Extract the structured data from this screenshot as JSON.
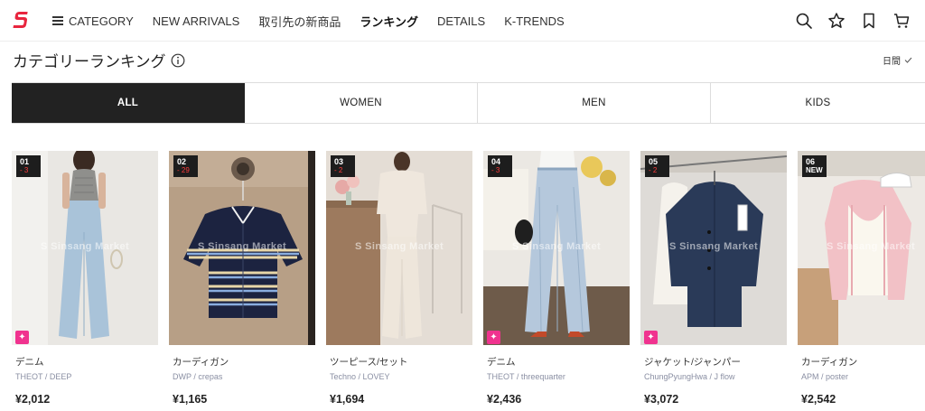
{
  "header": {
    "logo": "S",
    "nav": [
      {
        "label": "CATEGORY"
      },
      {
        "label": "NEW ARRIVALS"
      },
      {
        "label": "取引先の新商品"
      },
      {
        "label": "ランキング"
      },
      {
        "label": "DETAILS"
      },
      {
        "label": "K-TRENDS"
      }
    ],
    "icons": [
      "search-icon",
      "star-icon",
      "bookmark-icon",
      "cart-icon"
    ],
    "brand_color": "#e8253e"
  },
  "ranking": {
    "title": "カテゴリーランキング",
    "period": "日間"
  },
  "tabs": [
    {
      "label": "ALL"
    },
    {
      "label": "WOMEN"
    },
    {
      "label": "MEN"
    },
    {
      "label": "KIDS"
    }
  ],
  "watermark": "S Sinsang Market",
  "products": [
    {
      "rank": "01",
      "change": "- 3",
      "category": "デニム",
      "brand": "THEOT / DEEP",
      "price": "¥2,012"
    },
    {
      "rank": "02",
      "change": "- 29",
      "category": "カーディガン",
      "brand": "DWP / crepas",
      "price": "¥1,165"
    },
    {
      "rank": "03",
      "change": "- 2",
      "category": "ツーピース/セット",
      "brand": "Techno / LOVEY",
      "price": "¥1,694"
    },
    {
      "rank": "04",
      "change": "- 3",
      "category": "デニム",
      "brand": "THEOT / threequarter",
      "price": "¥2,436"
    },
    {
      "rank": "05",
      "change": "- 2",
      "category": "ジャケット/ジャンパー",
      "brand": "ChungPyungHwa / J flow",
      "price": "¥3,072"
    },
    {
      "rank": "06",
      "change": "NEW",
      "category": "カーディガン",
      "brand": "APM / poster",
      "price": "¥2,542"
    }
  ]
}
